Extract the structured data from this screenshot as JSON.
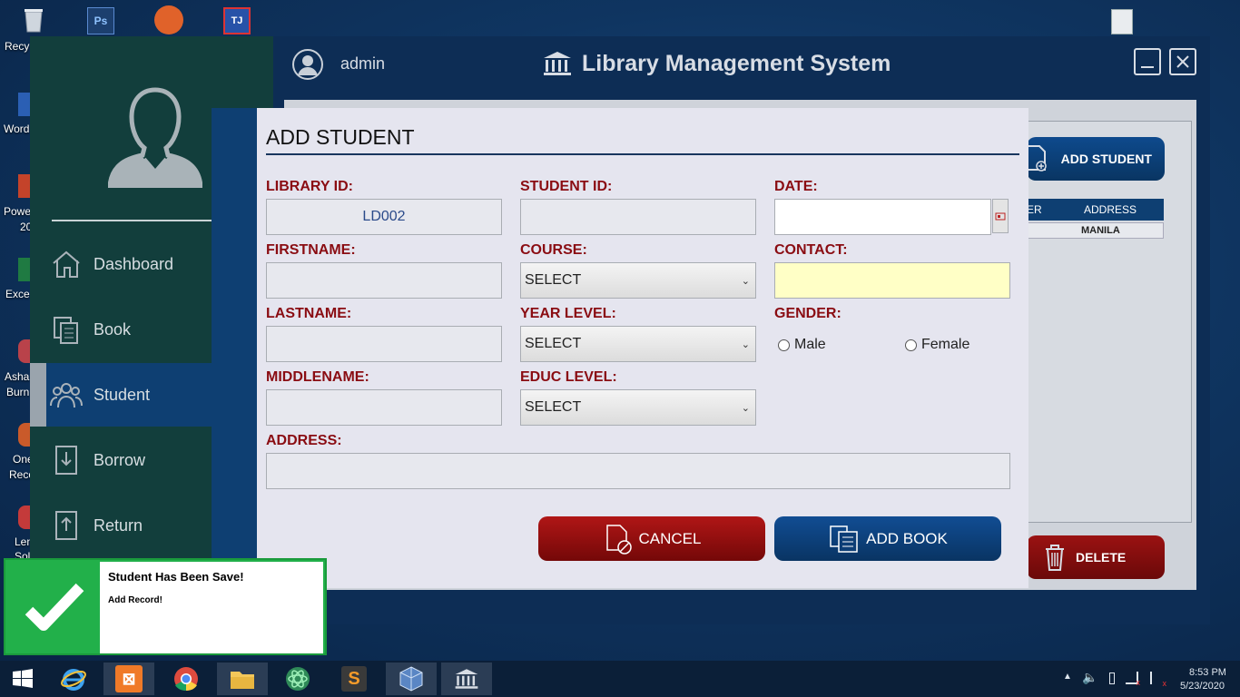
{
  "desktop": {
    "labels": [
      "Recy",
      "Word",
      "Powe",
      "20",
      "Exce",
      "Asha",
      "Burn",
      "One",
      "Reco",
      "Len",
      "Sol"
    ]
  },
  "header": {
    "user": "admin",
    "title": "Library Management System"
  },
  "sidebar": {
    "items": [
      {
        "label": "Dashboard"
      },
      {
        "label": "Book"
      },
      {
        "label": "Student"
      },
      {
        "label": "Borrow"
      },
      {
        "label": "Return"
      }
    ]
  },
  "background": {
    "add_student_label": "ADD STUDENT",
    "table_headers": [
      "ER",
      "ADDRESS"
    ],
    "table_row_address": "MANILA",
    "delete_label": "DELETE"
  },
  "dialog": {
    "title": "ADD STUDENT",
    "library_id_label": "LIBRARY ID:",
    "library_id_value": "LD002",
    "student_id_label": "STUDENT ID:",
    "date_label": "DATE:",
    "firstname_label": "FIRSTNAME:",
    "course_label": "COURSE:",
    "course_value": "SELECT",
    "contact_label": "CONTACT:",
    "lastname_label": "LASTNAME:",
    "year_level_label": "YEAR LEVEL:",
    "year_level_value": "SELECT",
    "gender_label": "GENDER:",
    "gender_male": "Male",
    "gender_female": "Female",
    "middlename_label": "MIDDLENAME:",
    "educ_level_label": "EDUC LEVEL:",
    "educ_level_value": "SELECT",
    "address_label": "ADDRESS:",
    "cancel_label": "CANCEL",
    "add_book_label": "ADD BOOK"
  },
  "notification": {
    "title": "Student Has Been Save!",
    "message": "Add Record!"
  },
  "taskbar": {
    "time": "8:53 PM",
    "date": "5/23/2020"
  },
  "colors": {
    "label_red": "#8a0c12",
    "nav_active": "#0e3f72",
    "sidebar": "#123e3c",
    "success_green": "#22b04a",
    "contact_field_bg": "#ffffc6"
  }
}
